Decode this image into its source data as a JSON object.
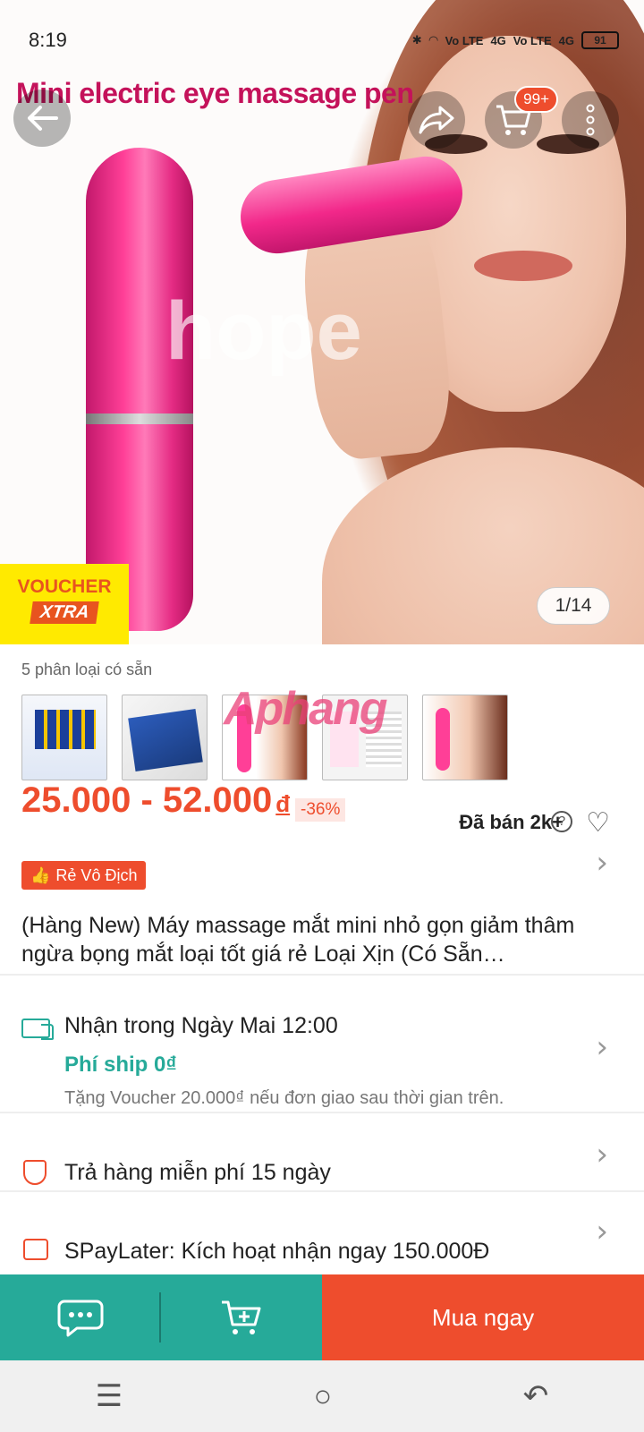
{
  "status_bar": {
    "time": "8:19",
    "network_1": "Vo LTE",
    "signal_1": "4G",
    "network_2": "Vo LTE",
    "signal_2": "4G",
    "battery": "91"
  },
  "hero": {
    "image_title": "Mini electric eye massage pen",
    "watermark": "hope",
    "cart_count": "99+",
    "counter": "1/14",
    "voucher_line1": "VOUCHER",
    "voucher_line2": "XTRA"
  },
  "variants": {
    "label": "5 phân loại có sẵn",
    "watermark": "Aphang"
  },
  "price": {
    "range": "25.000 - 52.000",
    "currency": "đ",
    "discount": "-36%",
    "sold": "Đã bán 2k+"
  },
  "badge": {
    "label": "Rẻ Vô Địch"
  },
  "product": {
    "title": "(Hàng New) Máy massage mắt mini nhỏ gọn giảm thâm ngừa bọng mắt loại tốt giá rẻ Loại Xịn (Có Sẵn…"
  },
  "delivery": {
    "eta": "Nhận trong Ngày Mai 12:00",
    "shipping": "Phí ship 0₫",
    "note": "Tặng Voucher 20.000₫ nếu đơn giao sau thời gian trên."
  },
  "returns": {
    "label": "Trả hàng miễn phí 15 ngày"
  },
  "spaylater": {
    "label": "SPayLater: Kích hoạt nhận ngay 150.000Đ"
  },
  "bottom_bar": {
    "buy_now": "Mua ngay"
  },
  "colors": {
    "brand": "#ee4d2d",
    "teal": "#26aa99"
  },
  "icons": [
    "back-icon",
    "share-icon",
    "cart-icon",
    "more-icon",
    "help-icon",
    "heart-icon",
    "thumbs-up-icon",
    "chevron-right-icon",
    "truck-icon",
    "shield-icon",
    "spaylater-icon",
    "chat-icon",
    "add-to-cart-icon",
    "menu-icon",
    "home-icon",
    "back-nav-icon"
  ]
}
